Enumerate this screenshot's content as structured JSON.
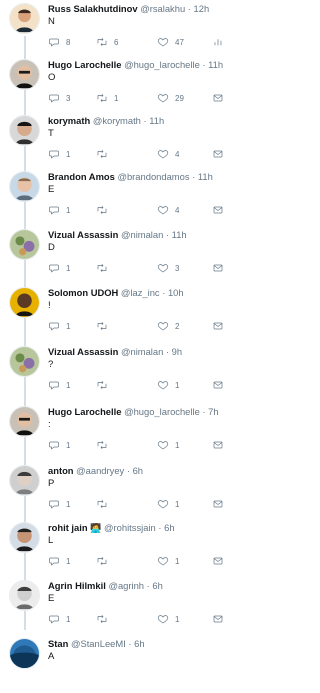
{
  "timeline": {
    "tweets": [
      {
        "name": "Russ Salakhutdinov",
        "handle": "@rsalakhu",
        "dot": "·",
        "time": "12h",
        "text": "N",
        "replies": "8",
        "retweets": "6",
        "likes": "47",
        "end_icon": "bar-chart-icon"
      },
      {
        "name": "Hugo Larochelle",
        "handle": "@hugo_larochelle",
        "dot": "·",
        "time": "11h",
        "text": "O",
        "replies": "3",
        "retweets": "1",
        "likes": "29",
        "end_icon": "mail-icon"
      },
      {
        "name": "korymath",
        "handle": "@korymath",
        "dot": "·",
        "time": "11h",
        "text": "T",
        "replies": "1",
        "retweets": "",
        "likes": "4",
        "end_icon": "mail-icon"
      },
      {
        "name": "Brandon Amos",
        "handle": "@brandondamos",
        "dot": "·",
        "time": "11h",
        "text": "E",
        "replies": "1",
        "retweets": "",
        "likes": "4",
        "end_icon": "mail-icon"
      },
      {
        "name": "Vizual Assassin",
        "handle": "@nimalan",
        "dot": "·",
        "time": "11h",
        "text": "D",
        "replies": "1",
        "retweets": "",
        "likes": "3",
        "end_icon": "mail-icon"
      },
      {
        "name": "Solomon UDOH",
        "handle": "@laz_inc",
        "dot": "·",
        "time": "10h",
        "text": "!",
        "replies": "1",
        "retweets": "",
        "likes": "2",
        "end_icon": "mail-icon"
      },
      {
        "name": "Vizual Assassin",
        "handle": "@nimalan",
        "dot": "·",
        "time": "9h",
        "text": "?",
        "replies": "1",
        "retweets": "",
        "likes": "1",
        "end_icon": "mail-icon"
      },
      {
        "name": "Hugo Larochelle",
        "handle": "@hugo_larochelle",
        "dot": "·",
        "time": "7h",
        "text": ":",
        "replies": "1",
        "retweets": "",
        "likes": "1",
        "end_icon": "mail-icon"
      },
      {
        "name": "anton",
        "handle": "@aandryey",
        "dot": "·",
        "time": "6h",
        "text": "P",
        "replies": "1",
        "retweets": "",
        "likes": "1",
        "end_icon": "mail-icon"
      },
      {
        "name": "rohit jain",
        "emoji": "🧑‍💻",
        "handle": "@rohitssjain",
        "dot": "·",
        "time": "6h",
        "text": "L",
        "replies": "1",
        "retweets": "",
        "likes": "1",
        "end_icon": "mail-icon"
      },
      {
        "name": "Agrin Hilmkil",
        "handle": "@agrinh",
        "dot": "·",
        "time": "6h",
        "text": "E",
        "replies": "1",
        "retweets": "",
        "likes": "1",
        "end_icon": "mail-icon"
      },
      {
        "name": "Stan",
        "handle": "@StanLeeMI",
        "dot": "·",
        "time": "6h",
        "text": "A",
        "replies": "",
        "retweets": "",
        "likes": "",
        "end_icon": ""
      }
    ]
  },
  "colors": {
    "thread_line": "#ccd6dd",
    "secondary_text": "#657786",
    "primary_text": "#14171a"
  }
}
